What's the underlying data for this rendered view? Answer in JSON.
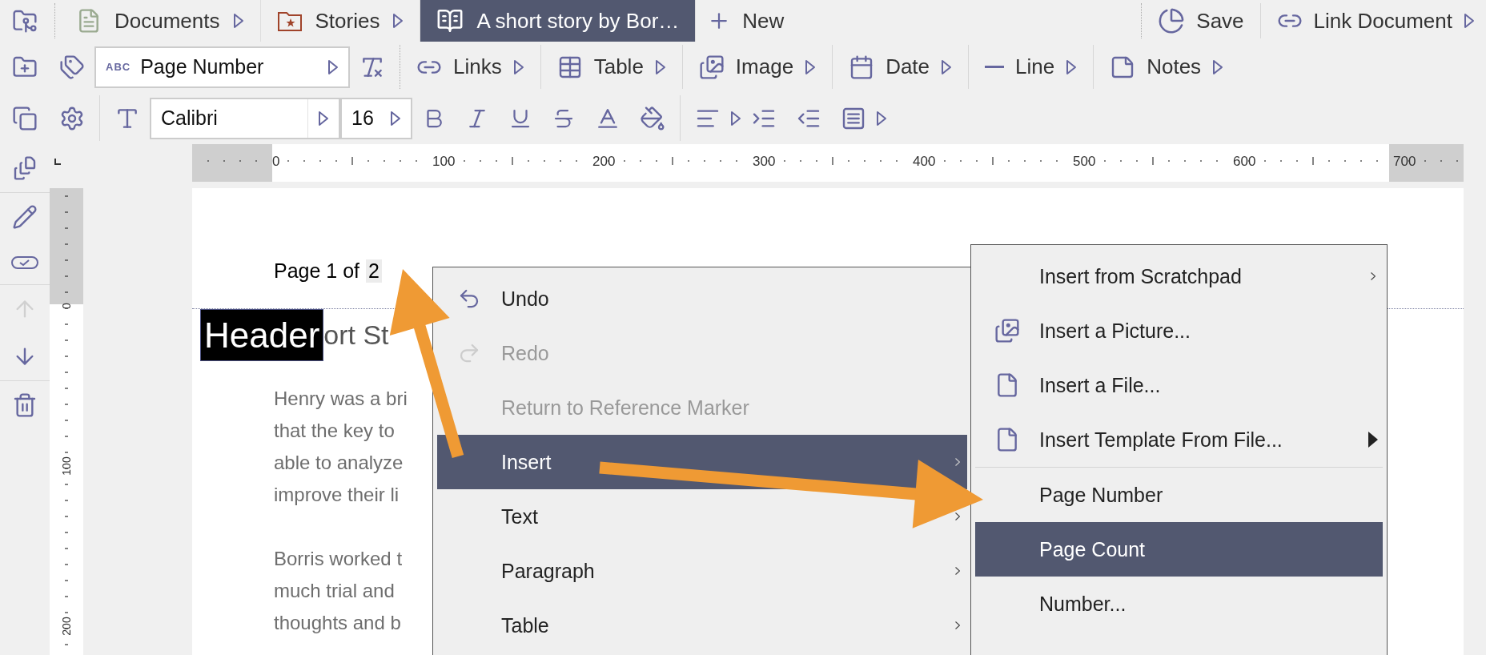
{
  "tabs": [
    {
      "label": "Documents",
      "kind": "document",
      "selected": false
    },
    {
      "label": "Stories",
      "kind": "folder",
      "selected": false
    },
    {
      "label": "A short story by Bor…",
      "kind": "book",
      "selected": true
    }
  ],
  "new_button": "New",
  "save_button": "Save",
  "link_button": "Link Document",
  "style_field": {
    "badge": "ABC",
    "value": "Page Number"
  },
  "insert_tools": [
    {
      "label": "Links",
      "kind": "link"
    },
    {
      "label": "Table",
      "kind": "table"
    },
    {
      "label": "Image",
      "kind": "image"
    },
    {
      "label": "Date",
      "kind": "date"
    },
    {
      "label": "Line",
      "kind": "line"
    },
    {
      "label": "Notes",
      "kind": "notes"
    }
  ],
  "font_field": {
    "value": "Calibri"
  },
  "size_field": {
    "value": "16"
  },
  "ruler": {
    "labels": [
      "0",
      "100",
      "200",
      "300",
      "400",
      "500",
      "600",
      "700"
    ]
  },
  "vertical_ruler": {
    "labels": [
      "0",
      "100",
      "200"
    ]
  },
  "page": {
    "header_text": "Page 1 of",
    "header_field": "2",
    "header_tag": "Header",
    "title": "ort St",
    "paragraphs": [
      [
        "Henry was a bri",
        "that the key to",
        "able to analyze",
        "improve their li"
      ],
      [
        "Borris worked t",
        "much trial and",
        "thoughts and b"
      ]
    ]
  },
  "context_menu": {
    "items": [
      {
        "label": "Undo",
        "kind": "undo",
        "disabled": false,
        "selected": false,
        "has_submenu": false
      },
      {
        "label": "Redo",
        "kind": "redo",
        "disabled": true,
        "selected": false,
        "has_submenu": false
      },
      {
        "label": "Return to Reference Marker",
        "kind": "plain",
        "disabled": true,
        "selected": false,
        "has_submenu": false
      },
      {
        "label": "Insert",
        "kind": "plain",
        "disabled": false,
        "selected": true,
        "has_submenu": true
      },
      {
        "label": "Text",
        "kind": "plain",
        "disabled": false,
        "selected": false,
        "has_submenu": true
      },
      {
        "label": "Paragraph",
        "kind": "plain",
        "disabled": false,
        "selected": false,
        "has_submenu": true
      },
      {
        "label": "Table",
        "kind": "plain",
        "disabled": false,
        "selected": false,
        "has_submenu": true
      }
    ]
  },
  "submenu": {
    "items": [
      {
        "label": "Insert from Scratchpad",
        "kind": "plain",
        "selected": false,
        "has_submenu": true,
        "filled_arrow": false
      },
      {
        "label": "Insert a Picture...",
        "kind": "picture",
        "selected": false,
        "has_submenu": false,
        "filled_arrow": false
      },
      {
        "label": "Insert a File...",
        "kind": "file",
        "selected": false,
        "has_submenu": false,
        "filled_arrow": false
      },
      {
        "label": "Insert Template From File...",
        "kind": "file",
        "selected": false,
        "has_submenu": true,
        "filled_arrow": true
      },
      {
        "kind": "separator"
      },
      {
        "label": "Page Number",
        "kind": "plain",
        "selected": false,
        "has_submenu": false,
        "filled_arrow": false
      },
      {
        "label": "Page Count",
        "kind": "plain",
        "selected": true,
        "has_submenu": false,
        "filled_arrow": false
      },
      {
        "label": "Number...",
        "kind": "plain",
        "selected": false,
        "has_submenu": false,
        "filled_arrow": false
      }
    ]
  }
}
